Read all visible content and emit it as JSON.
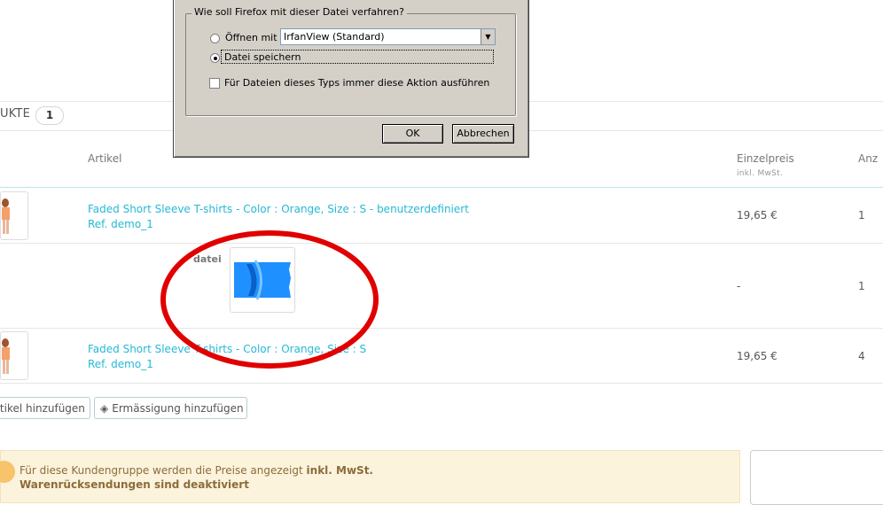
{
  "products_section": {
    "title": "UKTE",
    "count": "1"
  },
  "table": {
    "headers": {
      "article": "Artikel",
      "unit_price": "Einzelpreis",
      "unit_price_sub": "inkl. MwSt.",
      "quantity": "Anz"
    },
    "rows": [
      {
        "name": "Faded Short Sleeve T-shirts - Color : Orange, Size : S - benutzerdefiniert",
        "ref": "Ref. demo_1",
        "price": "19,65 €",
        "qty": "1"
      },
      {
        "file_label": "datei",
        "price": "-",
        "qty": "1"
      },
      {
        "name": "Faded Short Sleeve T-shirts - Color : Orange, Size : S",
        "ref": "Ref. demo_1",
        "price": "19,65 €",
        "qty": "4"
      }
    ]
  },
  "actions": {
    "add_article": "rtikel hinzufügen",
    "add_discount": "Ermässigung hinzufügen",
    "discount_icon": "tag-icon"
  },
  "notice": {
    "text": "Für diese Kundengruppe werden die Preise angezeigt ",
    "text_bold": "inkl. MwSt.",
    "line2": "Warenrücksendungen sind deaktiviert"
  },
  "dialog": {
    "legend": "Wie soll Firefox mit dieser Datei verfahren?",
    "open_with_label": "Öffnen mit",
    "open_with_value": "IrfanView (Standard)",
    "save_label": "Datei speichern",
    "always_label": "Für Dateien dieses Typs immer diese Aktion ausführen",
    "ok": "OK",
    "cancel": "Abbrechen"
  },
  "colors": {
    "link": "#25b9d7",
    "notice_bg": "#fcf3dc",
    "annotation_red": "#e00000",
    "dialog_bg": "#d4d0c8"
  }
}
